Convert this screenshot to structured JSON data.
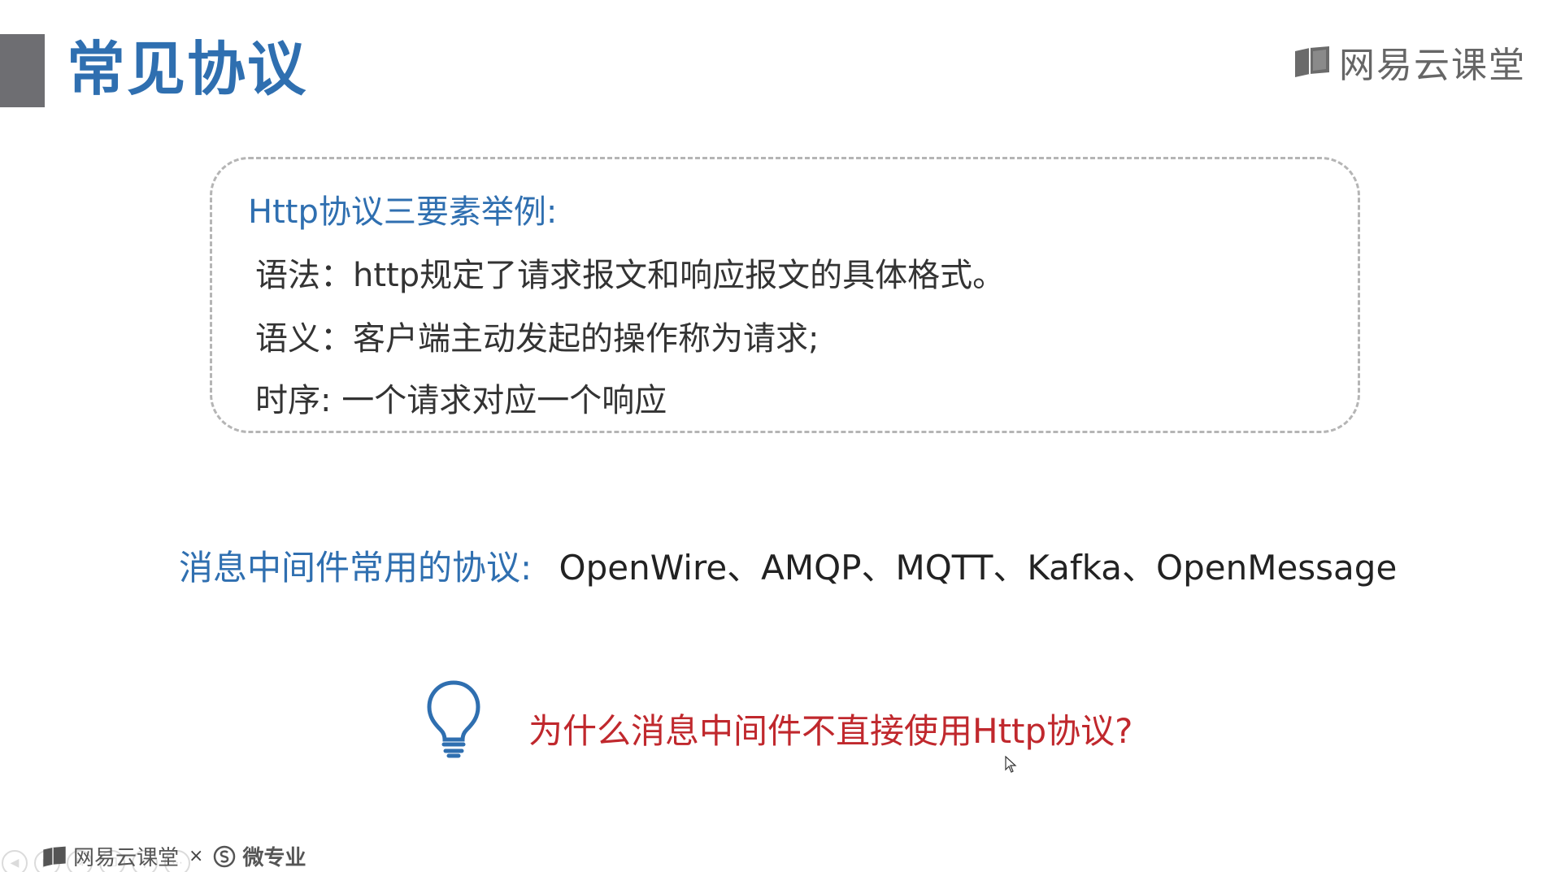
{
  "slide": {
    "title": "常见协议",
    "brand": "网易云课堂"
  },
  "box": {
    "heading": "Http协议三要素举例:",
    "lines": [
      "语法：http规定了请求报文和响应报文的具体格式。",
      "语义：客户端主动发起的操作称为请求;",
      "时序: 一个请求对应一个响应"
    ]
  },
  "protocols": {
    "label": "消息中间件常用的协议:",
    "value": "OpenWire、AMQP、MQTT、Kafka、OpenMessage"
  },
  "question": "为什么消息中间件不直接使用Http协议?",
  "footer": {
    "brand": "网易云课堂",
    "separator": "×",
    "partner": "微专业"
  },
  "colors": {
    "title": "#2f6fb0",
    "accent_bar": "#6e6e72",
    "question": "#c0282d",
    "box_border": "#b5b5b5"
  },
  "icons": {
    "brand": "book-logo-icon",
    "bulb": "lightbulb-icon",
    "cursor": "mouse-cursor-icon",
    "partner": "s-circle-icon"
  }
}
